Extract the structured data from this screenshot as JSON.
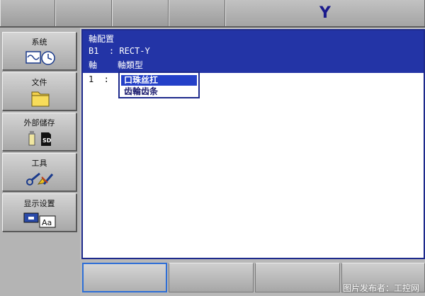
{
  "header": {
    "axis_indicator": "Y"
  },
  "sidebar": {
    "items": [
      {
        "label": "系统",
        "icon": "signal-clock-icon"
      },
      {
        "label": "文件",
        "icon": "folder-icon"
      },
      {
        "label": "外部儲存",
        "icon": "sd-card-icon"
      },
      {
        "label": "工具",
        "icon": "tools-icon"
      },
      {
        "label": "显示设置",
        "icon": "display-font-icon"
      }
    ]
  },
  "panel": {
    "title": "軸配置",
    "line_b1": "B1  : RECT-Y",
    "line_axis": "軸    軸類型",
    "row_1": "1  :"
  },
  "dropdown": {
    "options": [
      "口珠丝扛",
      "齿輪齿条"
    ],
    "selected_index": 0
  },
  "footer": {
    "watermark": "图片发布者：工控网"
  },
  "colors": {
    "header_blue": "#2334a6",
    "selection_blue": "#2440c8",
    "axis_text": "#1a1a8c"
  }
}
